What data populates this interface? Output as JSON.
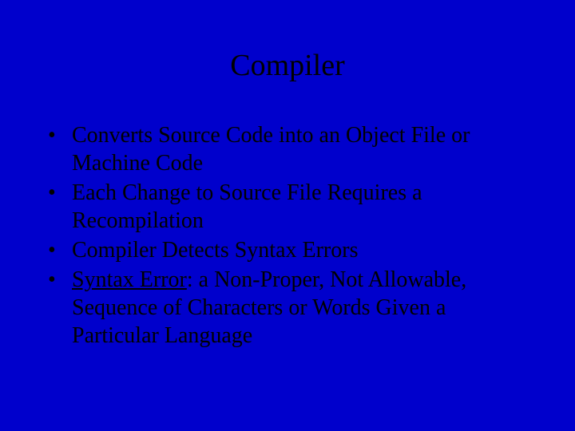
{
  "title": "Compiler",
  "bullets": {
    "b1": "Converts Source Code into an Object File or Machine Code",
    "b2": "Each Change to Source File Requires a Recompilation",
    "b3": "Compiler Detects Syntax Errors",
    "b4_term": "Syntax Error",
    "b4_rest": ": a Non-Proper, Not Allowable, Sequence of Characters or Words Given a Particular Language"
  }
}
